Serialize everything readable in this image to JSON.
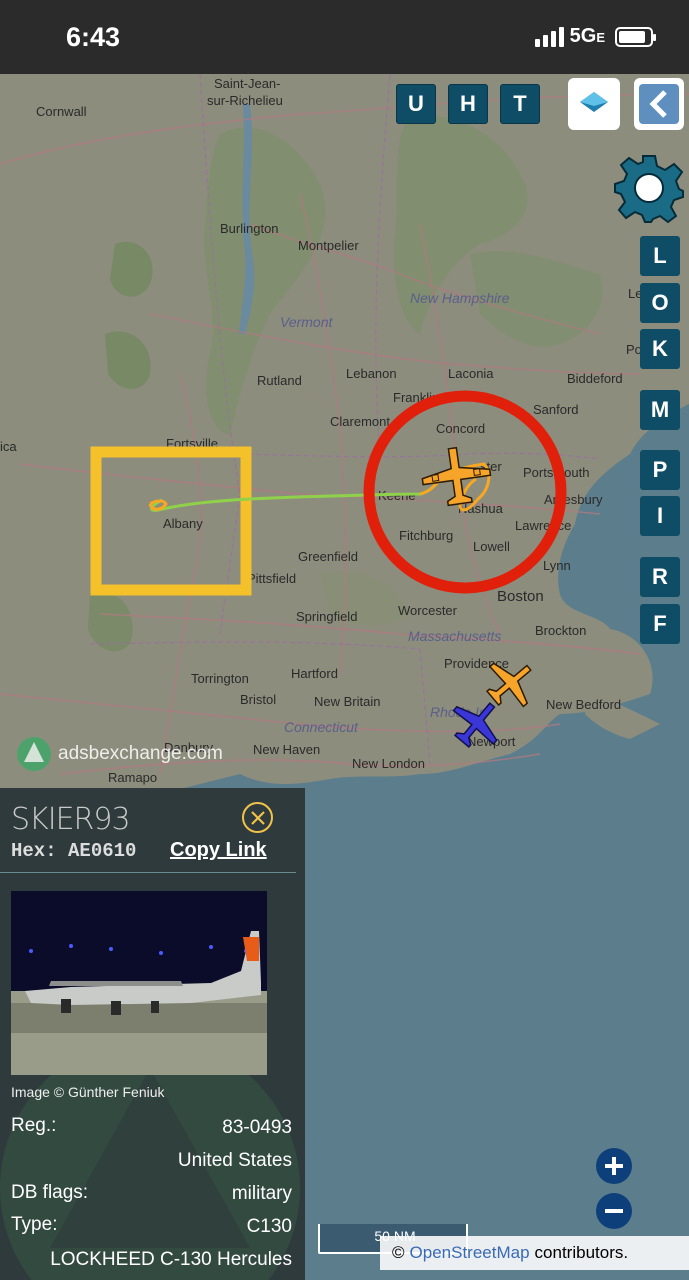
{
  "status_bar": {
    "time": "6:43",
    "network": "5G",
    "network_suffix": "E"
  },
  "toolbar": {
    "buttons": [
      "U",
      "H",
      "T"
    ]
  },
  "side_buttons": [
    "L",
    "O",
    "K",
    "M",
    "P",
    "I",
    "R",
    "F"
  ],
  "map": {
    "places": [
      {
        "id": "cornwall",
        "label": "Cornwall"
      },
      {
        "id": "saint-jean",
        "label": "Saint-Jean-"
      },
      {
        "id": "sur-richelieu",
        "label": "sur-Richelieu"
      },
      {
        "id": "burlington",
        "label": "Burlington"
      },
      {
        "id": "montpelier",
        "label": "Montpelier"
      },
      {
        "id": "lewiston",
        "label": "Lewist"
      },
      {
        "id": "vermont",
        "label": "Vermont",
        "state": true
      },
      {
        "id": "new-hampshire",
        "label": "New Hampshire",
        "state": true
      },
      {
        "id": "portland",
        "label": "Portlar"
      },
      {
        "id": "rutland",
        "label": "Rutland"
      },
      {
        "id": "lebanon",
        "label": "Lebanon"
      },
      {
        "id": "laconia",
        "label": "Laconia"
      },
      {
        "id": "biddeford",
        "label": "Biddeford"
      },
      {
        "id": "franklin",
        "label": "Franklin"
      },
      {
        "id": "sanford",
        "label": "Sanford"
      },
      {
        "id": "claremont",
        "label": "Claremont"
      },
      {
        "id": "concord",
        "label": "Concord"
      },
      {
        "id": "fortsville",
        "label": "Fortsville"
      },
      {
        "id": "ica",
        "label": "ica"
      },
      {
        "id": "portsmouth",
        "label": "Portsmouth"
      },
      {
        "id": "amesbury",
        "label": "Amesbury"
      },
      {
        "id": "manchester",
        "label": "ster"
      },
      {
        "id": "keene",
        "label": "Keene"
      },
      {
        "id": "nashua",
        "label": "Nashua"
      },
      {
        "id": "albany",
        "label": "Albany"
      },
      {
        "id": "lawrence",
        "label": "Lawrence"
      },
      {
        "id": "fitchburg",
        "label": "Fitchburg"
      },
      {
        "id": "lowell",
        "label": "Lowell"
      },
      {
        "id": "greenfield",
        "label": "Greenfield"
      },
      {
        "id": "lynn",
        "label": "Lynn"
      },
      {
        "id": "pittsfield",
        "label": "Pittsfield"
      },
      {
        "id": "boston",
        "label": "Boston"
      },
      {
        "id": "springfield",
        "label": "Springfield"
      },
      {
        "id": "worcester",
        "label": "Worcester"
      },
      {
        "id": "brockton",
        "label": "Brockton"
      },
      {
        "id": "massachusetts",
        "label": "Massachusetts",
        "state": true
      },
      {
        "id": "providence",
        "label": "Providence"
      },
      {
        "id": "torrington",
        "label": "Torrington"
      },
      {
        "id": "hartford",
        "label": "Hartford"
      },
      {
        "id": "bristol",
        "label": "Bristol"
      },
      {
        "id": "new-britain",
        "label": "New Britain"
      },
      {
        "id": "new-bedford",
        "label": "New Bedford"
      },
      {
        "id": "rhode-island",
        "label": "Rhode Is",
        "state": true
      },
      {
        "id": "connecticut",
        "label": "Connecticut",
        "state": true
      },
      {
        "id": "danbury",
        "label": "Danbury"
      },
      {
        "id": "new-haven",
        "label": "New Haven"
      },
      {
        "id": "newport",
        "label": "Newport"
      },
      {
        "id": "ramapo",
        "label": "Ramapo"
      },
      {
        "id": "new-london",
        "label": "New London"
      }
    ],
    "watermark": "adsbexchange.com",
    "scale": "50 NM",
    "attribution_prefix": "©",
    "attribution_link": "OpenStreetMap",
    "attribution_suffix": "contributors."
  },
  "aircraft_panel": {
    "callsign": "SKIER93",
    "hex_label": "Hex: AE0610",
    "copy_link": "Copy Link",
    "image_credit": "Image © Günther Feniuk",
    "reg_label": "Reg.:",
    "reg_value": "83-0493",
    "country": "United States",
    "db_flags_label": "DB flags:",
    "db_flags_value": "military",
    "type_label": "Type:",
    "type_value": "C130",
    "type_full": "LOCKHEED C-130 Hercules"
  },
  "colors": {
    "toolbar_button": "#0f4d66",
    "highlight_box": "#f5c12b",
    "highlight_circle": "#e0200a",
    "track_green": "#8fd14a",
    "track_orange": "#f7a722",
    "aircraft_orange": "#f7a42a",
    "aircraft_blue": "#3a36d8",
    "zoom_button": "#0d3f7a"
  }
}
